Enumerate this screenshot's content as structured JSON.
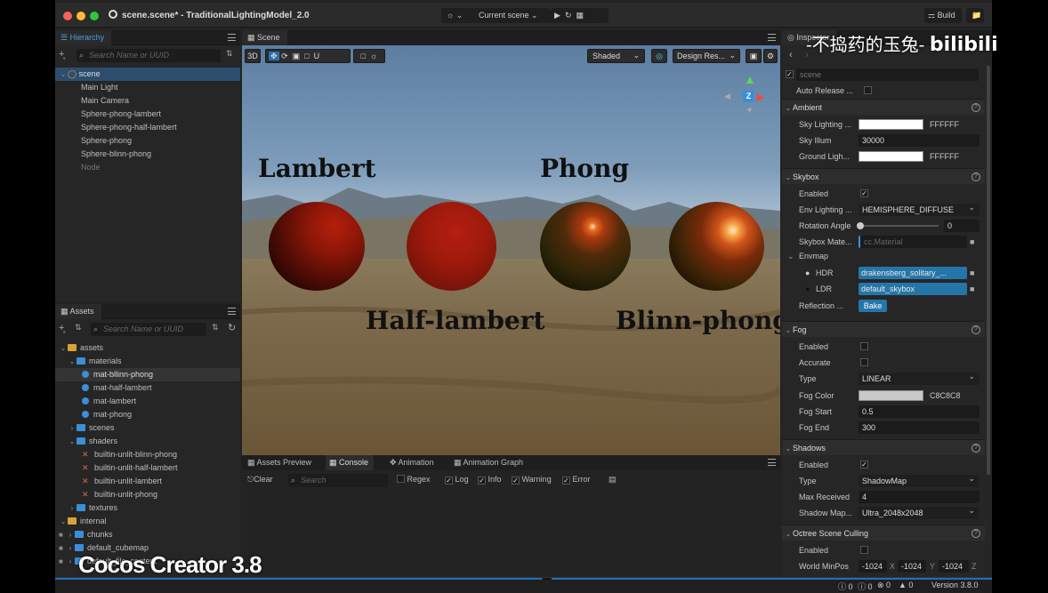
{
  "window": {
    "title": "scene.scene* - TraditionalLightingModel_2.0",
    "current_scene": "Current scene",
    "build_label": "Build"
  },
  "hierarchy": {
    "tab": "Hierarchy",
    "search_placeholder": "Search Name or UUID",
    "root": "scene",
    "items": [
      "Main Light",
      "Main Camera",
      "Sphere-phong-lambert",
      "Sphere-phong-half-lambert",
      "Sphere-phong",
      "Sphere-blinn-phong",
      "Node"
    ]
  },
  "assets": {
    "tab": "Assets",
    "search_placeholder": "Search Name or UUID",
    "items": [
      {
        "label": "assets"
      },
      {
        "label": "materials"
      },
      {
        "label": "mat-bllinn-phong"
      },
      {
        "label": "mat-half-lambert"
      },
      {
        "label": "mat-lambert"
      },
      {
        "label": "mat-phong"
      },
      {
        "label": "scenes"
      },
      {
        "label": "shaders"
      },
      {
        "label": "builtin-unlit-blinn-phong"
      },
      {
        "label": "builtin-unlit-half-lambert"
      },
      {
        "label": "builtin-unlit-lambert"
      },
      {
        "label": "builtin-unlit-phong"
      },
      {
        "label": "textures"
      },
      {
        "label": "internal"
      },
      {
        "label": "chunks"
      },
      {
        "label": "default_cubemap"
      },
      {
        "label": "default_file_content"
      }
    ]
  },
  "scene_view": {
    "tab": "Scene",
    "mode_3d": "3D",
    "shading": "Shaded",
    "resolution": "Design Res...",
    "gizmo_axis": "Z",
    "labels": {
      "lambert": "Lambert",
      "phong": "Phong",
      "half_lambert": "Half-lambert",
      "blinn_phong": "Blinn-phong"
    }
  },
  "console": {
    "tabs": [
      "Assets Preview",
      "Console",
      "Animation",
      "Animation Graph"
    ],
    "clear": "Clear",
    "search_placeholder": "Search",
    "filters": [
      "Regex",
      "Log",
      "Info",
      "Warning",
      "Error"
    ]
  },
  "inspector": {
    "tab": "Inspector",
    "node_name": "scene",
    "auto_release": "Auto Release ...",
    "ambient": {
      "title": "Ambient",
      "sky_lighting_label": "Sky Lighting ...",
      "sky_lighting_hex": "FFFFFF",
      "sky_illum_label": "Sky Illum",
      "sky_illum_value": "30000",
      "ground_label": "Ground Ligh...",
      "ground_hex": "FFFFFF"
    },
    "skybox": {
      "title": "Skybox",
      "enabled_label": "Enabled",
      "env_label": "Env Lighting ...",
      "env_value": "HEMISPHERE_DIFFUSE",
      "rotation_label": "Rotation Angle",
      "rotation_value": "0",
      "material_label": "Skybox Mate...",
      "material_placeholder": "cc.Material",
      "envmap_label": "Envmap",
      "hdr_label": "HDR",
      "hdr_value": "drakensberg_solitary_...",
      "ldr_label": "LDR",
      "ldr_value": "default_skybox",
      "reflection_label": "Reflection ...",
      "bake_label": "Bake"
    },
    "fog": {
      "title": "Fog",
      "enabled_label": "Enabled",
      "accurate_label": "Accurate",
      "type_label": "Type",
      "type_value": "LINEAR",
      "color_label": "Fog Color",
      "color_hex": "C8C8C8",
      "start_label": "Fog Start",
      "start_value": "0.5",
      "end_label": "Fog End",
      "end_value": "300"
    },
    "shadows": {
      "title": "Shadows",
      "enabled_label": "Enabled",
      "type_label": "Type",
      "type_value": "ShadowMap",
      "max_label": "Max Received",
      "max_value": "4",
      "map_label": "Shadow Map...",
      "map_value": "Ultra_2048x2048"
    },
    "octree": {
      "title": "Octree Scene Culling",
      "enabled_label": "Enabled",
      "minpos_label": "World MinPos",
      "x": "-1024",
      "y": "-1024",
      "z": "-1024",
      "x_axis": "X",
      "y_axis": "Y",
      "z_axis": "Z"
    }
  },
  "status": {
    "counts": [
      "0",
      "0",
      "0",
      "0"
    ],
    "version": "Version 3.8.0"
  },
  "overlays": {
    "caption": "Cocos Creator 3.8",
    "watermark": "-不捣药的玉兔-",
    "logo": "bilibili"
  },
  "colors": {
    "accent": "#3a8fd8",
    "selection": "#2c4d6e",
    "panel": "#262626"
  }
}
